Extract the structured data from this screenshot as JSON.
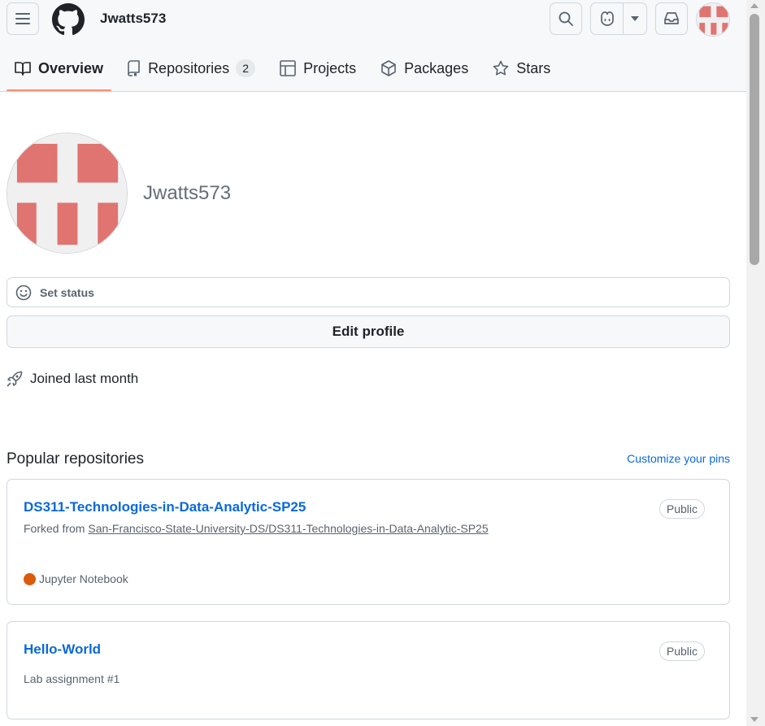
{
  "header": {
    "username": "Jwatts573"
  },
  "tabs": [
    {
      "label": "Overview",
      "active": true
    },
    {
      "label": "Repositories",
      "count": "2"
    },
    {
      "label": "Projects"
    },
    {
      "label": "Packages"
    },
    {
      "label": "Stars"
    }
  ],
  "profile": {
    "login": "Jwatts573",
    "set_status": "Set status",
    "edit_profile": "Edit profile",
    "joined": "Joined last month"
  },
  "popular": {
    "title": "Popular repositories",
    "customize": "Customize your pins",
    "repos": [
      {
        "name": "DS311-Technologies-in-Data-Analytic-SP25",
        "visibility": "Public",
        "forked_prefix": "Forked from ",
        "forked_from": "San-Francisco-State-University-DS/DS311-Technologies-in-Data-Analytic-SP25",
        "language": "Jupyter Notebook",
        "language_color": "#da5b0b"
      },
      {
        "name": "Hello-World",
        "visibility": "Public",
        "description": "Lab assignment #1"
      }
    ]
  },
  "colors": {
    "accent_link": "#0969da",
    "tab_underline": "#fd8c73",
    "identicon": "#e07470"
  },
  "icons": [
    "hamburger-icon",
    "github-logo-icon",
    "search-icon",
    "copilot-icon",
    "triangle-down-icon",
    "inbox-icon",
    "book-icon",
    "repo-icon",
    "table-icon",
    "package-icon",
    "star-icon",
    "smiley-icon",
    "rocket-icon"
  ]
}
